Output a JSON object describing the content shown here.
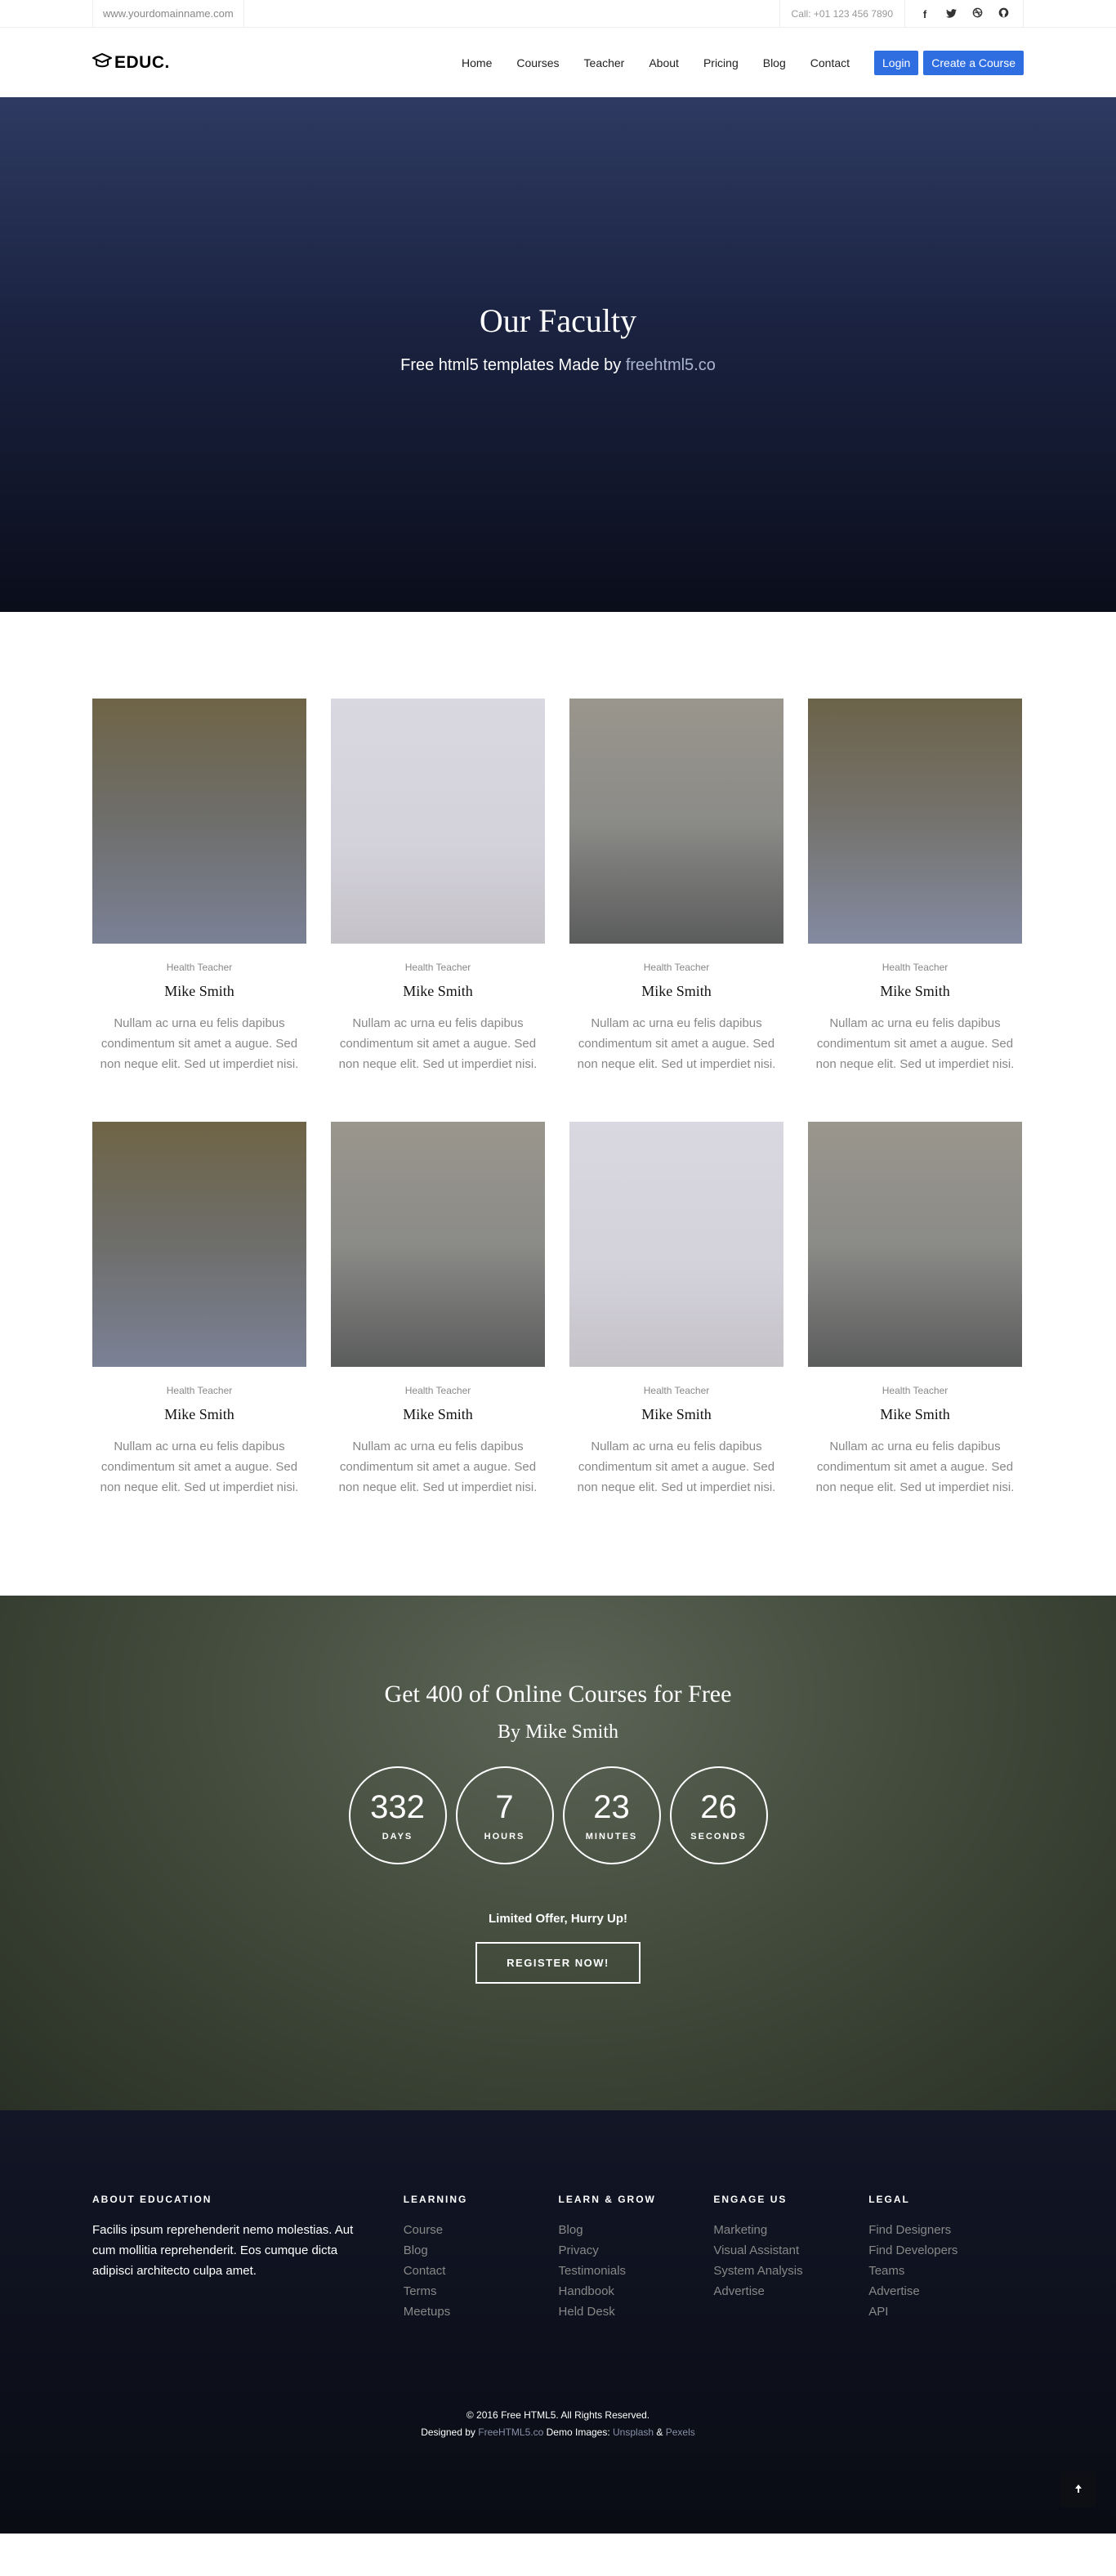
{
  "topbar": {
    "domain": "www.yourdomainname.com",
    "call_label": "Call:",
    "phone": "+01 123 456 7890",
    "social_icons": [
      "facebook-icon",
      "twitter-icon",
      "dribbble-icon",
      "github-icon"
    ]
  },
  "header": {
    "logo": "EDUC.",
    "nav": [
      "Home",
      "Courses",
      "Teacher",
      "About",
      "Pricing",
      "Blog",
      "Contact"
    ],
    "login": "Login",
    "create_course": "Create a Course"
  },
  "hero": {
    "title": "Our Faculty",
    "subtitle_prefix": "Free html5 templates Made by",
    "subtitle_link": "freehtml5.co"
  },
  "faculty": {
    "members": [
      {
        "role": "Health Teacher",
        "name": "Mike Smith",
        "desc": "Nullam ac urna eu felis dapibus condimentum sit amet a augue. Sed non neque elit. Sed ut imperdiet nisi."
      },
      {
        "role": "Health Teacher",
        "name": "Mike Smith",
        "desc": "Nullam ac urna eu felis dapibus condimentum sit amet a augue. Sed non neque elit. Sed ut imperdiet nisi."
      },
      {
        "role": "Health Teacher",
        "name": "Mike Smith",
        "desc": "Nullam ac urna eu felis dapibus condimentum sit amet a augue. Sed non neque elit. Sed ut imperdiet nisi."
      },
      {
        "role": "Health Teacher",
        "name": "Mike Smith",
        "desc": "Nullam ac urna eu felis dapibus condimentum sit amet a augue. Sed non neque elit. Sed ut imperdiet nisi."
      },
      {
        "role": "Health Teacher",
        "name": "Mike Smith",
        "desc": "Nullam ac urna eu felis dapibus condimentum sit amet a augue. Sed non neque elit. Sed ut imperdiet nisi."
      },
      {
        "role": "Health Teacher",
        "name": "Mike Smith",
        "desc": "Nullam ac urna eu felis dapibus condimentum sit amet a augue. Sed non neque elit. Sed ut imperdiet nisi."
      },
      {
        "role": "Health Teacher",
        "name": "Mike Smith",
        "desc": "Nullam ac urna eu felis dapibus condimentum sit amet a augue. Sed non neque elit. Sed ut imperdiet nisi."
      },
      {
        "role": "Health Teacher",
        "name": "Mike Smith",
        "desc": "Nullam ac urna eu felis dapibus condimentum sit amet a augue. Sed non neque elit. Sed ut imperdiet nisi."
      }
    ]
  },
  "countdown": {
    "title": "Get 400 of Online Courses for Free",
    "subtitle": "By Mike Smith",
    "timers": [
      {
        "value": "332",
        "label": "DAYS"
      },
      {
        "value": "7",
        "label": "HOURS"
      },
      {
        "value": "23",
        "label": "MINUTES"
      },
      {
        "value": "26",
        "label": "SECONDS"
      }
    ],
    "offer": "Limited Offer, Hurry Up!",
    "register": "REGISTER NOW!"
  },
  "footer": {
    "about_title": "ABOUT EDUCATION",
    "about_text": "Facilis ipsum reprehenderit nemo molestias. Aut cum mollitia reprehenderit. Eos cumque dicta adipisci architecto culpa amet.",
    "columns": [
      {
        "title": "LEARNING",
        "items": [
          "Course",
          "Blog",
          "Contact",
          "Terms",
          "Meetups"
        ]
      },
      {
        "title": "LEARN & GROW",
        "items": [
          "Blog",
          "Privacy",
          "Testimonials",
          "Handbook",
          "Held Desk"
        ]
      },
      {
        "title": "ENGAGE US",
        "items": [
          "Marketing",
          "Visual Assistant",
          "System Analysis",
          "Advertise"
        ]
      },
      {
        "title": "LEGAL",
        "items": [
          "Find Designers",
          "Find Developers",
          "Teams",
          "Advertise",
          "API"
        ]
      }
    ],
    "copyright": "© 2016 Free HTML5. All Rights Reserved.",
    "designed_by_label": "Designed by",
    "designed_by_link": "FreeHTML5.co",
    "demo_images_label": "Demo Images:",
    "demo_link_1": "Unsplash",
    "amp": "&",
    "demo_link_2": "Pexels",
    "to_top_icon": "arrow-up-icon"
  }
}
